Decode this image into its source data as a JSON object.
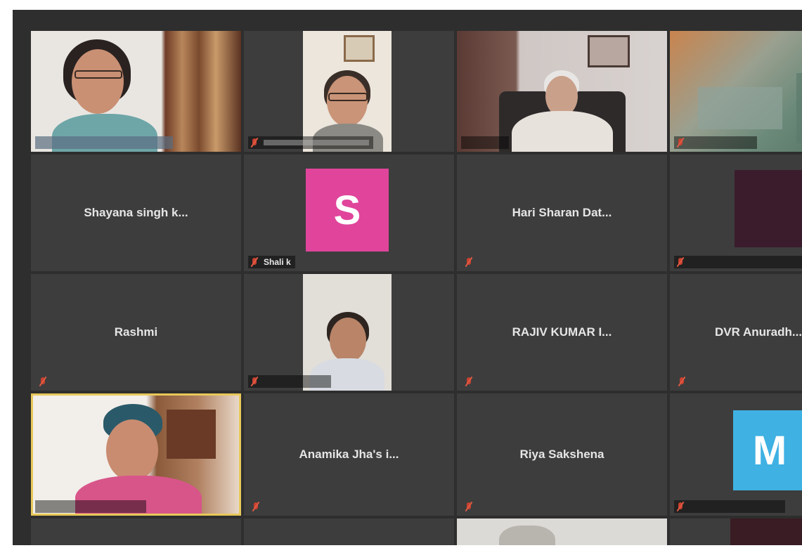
{
  "meeting": {
    "participants": [
      {
        "name": "",
        "type": "video"
      },
      {
        "name": "",
        "type": "video"
      },
      {
        "name": "",
        "type": "video"
      },
      {
        "name": "",
        "type": "video"
      },
      {
        "name": "Shayana singh k...",
        "type": "name"
      },
      {
        "name": "Shali k",
        "avatar_letter": "S",
        "avatar_color": "#e0459b",
        "type": "avatar"
      },
      {
        "name": "Hari Sharan Dat...",
        "type": "name"
      },
      {
        "name": "",
        "type": "video"
      },
      {
        "name": "Rashmi",
        "type": "name"
      },
      {
        "name": "",
        "type": "video"
      },
      {
        "name": "RAJIV KUMAR I...",
        "type": "name"
      },
      {
        "name": "DVR Anuradh...",
        "type": "name"
      },
      {
        "name": "",
        "type": "video",
        "active_speaker": true
      },
      {
        "name": "Anamika Jha's i...",
        "type": "name"
      },
      {
        "name": "Riya Sakshena",
        "type": "name"
      },
      {
        "name": "",
        "avatar_letter": "M",
        "avatar_color": "#3fb1e3",
        "type": "avatar"
      }
    ]
  },
  "colors": {
    "background": "#2e2e2e",
    "tile": "#3d3d3d",
    "active_speaker_border": "#e8c85a",
    "mute_icon": "#c9412f"
  }
}
